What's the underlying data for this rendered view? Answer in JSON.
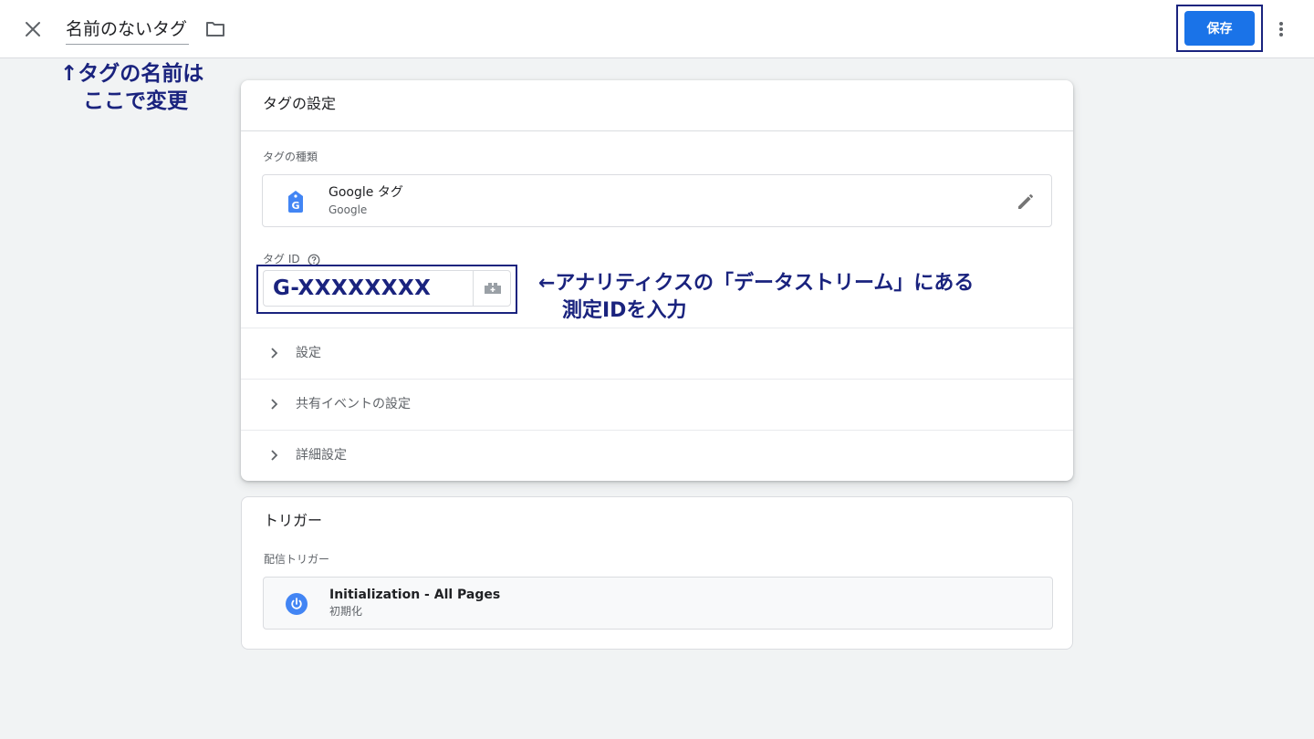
{
  "header": {
    "tag_name": "名前のないタグ",
    "save_label": "保存"
  },
  "annotations": {
    "name_line1": "↑タグの名前は",
    "name_line2": "ここで変更",
    "id_line1": "←アナリティクスの「データストリーム」にある",
    "id_line2": "測定IDを入力"
  },
  "config": {
    "title": "タグの設定",
    "type_label": "タグの種類",
    "type_name": "Google タグ",
    "type_vendor": "Google",
    "id_label": "タグ ID",
    "id_value": "G-XXXXXXXX",
    "rows": [
      {
        "label": "設定"
      },
      {
        "label": "共有イベントの設定"
      },
      {
        "label": "詳細設定"
      }
    ]
  },
  "trigger": {
    "title": "トリガー",
    "firing_label": "配信トリガー",
    "name": "Initialization - All Pages",
    "type": "初期化"
  },
  "colors": {
    "accent": "#1a73e8",
    "annotation": "#1a237e",
    "background": "#f1f3f4"
  },
  "icons": [
    "close-icon",
    "folder-icon",
    "more-vert-icon",
    "google-tag-icon",
    "pencil-icon",
    "help-icon",
    "variable-icon",
    "chevron-right-icon",
    "power-icon"
  ]
}
